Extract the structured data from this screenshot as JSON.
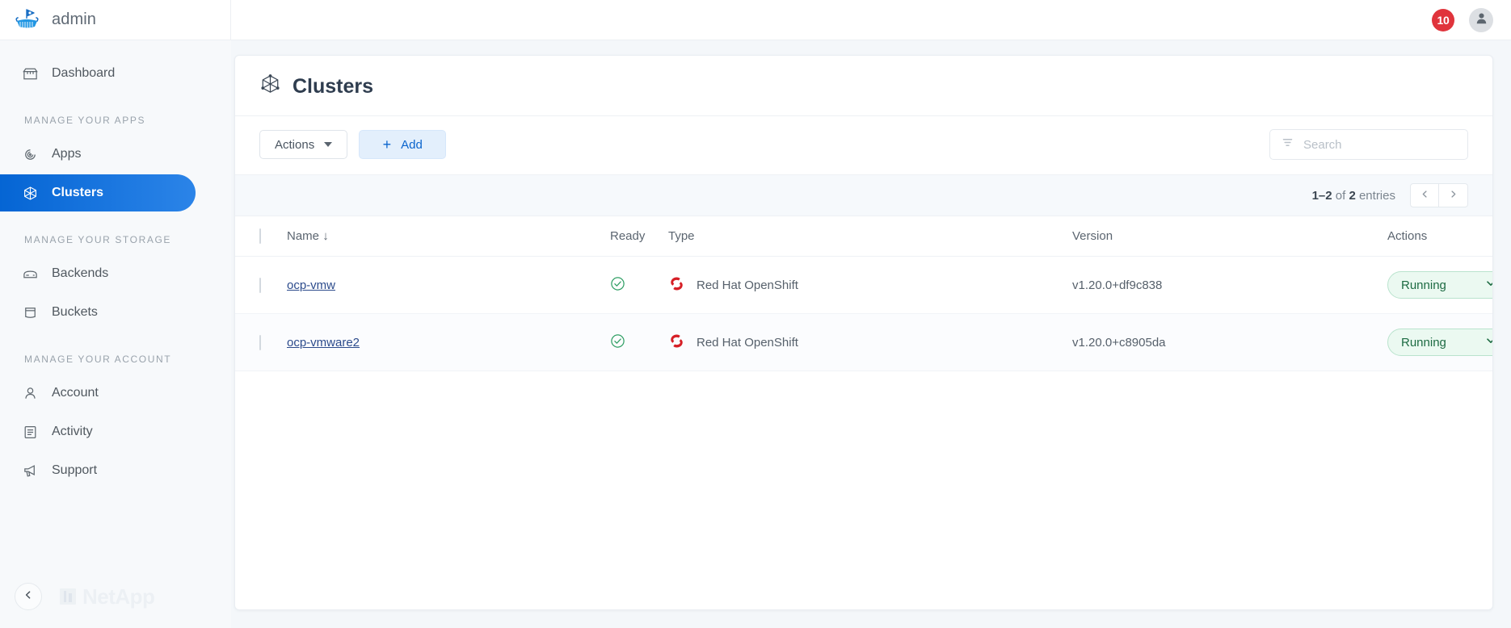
{
  "topbar": {
    "brand_name": "admin",
    "logo_icon": "viking-ship-logo",
    "notification_count": "10",
    "avatar_icon": "user-avatar-icon"
  },
  "sidebar": {
    "items": [
      {
        "label": "Dashboard",
        "icon": "dashboard-icon",
        "active": false
      },
      {
        "label": "Apps",
        "icon": "apps-icon",
        "active": false
      },
      {
        "label": "Clusters",
        "icon": "clusters-cube-icon",
        "active": true
      },
      {
        "label": "Backends",
        "icon": "backends-icon",
        "active": false
      },
      {
        "label": "Buckets",
        "icon": "buckets-icon",
        "active": false
      },
      {
        "label": "Account",
        "icon": "account-person-icon",
        "active": false
      },
      {
        "label": "Activity",
        "icon": "activity-list-icon",
        "active": false
      },
      {
        "label": "Support",
        "icon": "support-megaphone-icon",
        "active": false
      }
    ],
    "groups": {
      "apps": "MANAGE YOUR APPS",
      "storage": "MANAGE YOUR STORAGE",
      "account": "MANAGE YOUR ACCOUNT"
    },
    "footer": {
      "collapse_icon": "chevron-left-icon",
      "vendor": "NetApp"
    }
  },
  "page": {
    "title": "Clusters",
    "title_icon": "clusters-cube-icon"
  },
  "toolbar": {
    "actions_label": "Actions",
    "add_label": "Add",
    "search_placeholder": "Search",
    "search_value": "",
    "filter_icon": "filter-icon"
  },
  "pagination": {
    "range": "1–2",
    "of": " of ",
    "total": "2",
    "suffix": " entries",
    "prev_icon": "chevron-left-icon",
    "next_icon": "chevron-right-icon"
  },
  "table": {
    "columns": {
      "name": "Name",
      "ready": "Ready",
      "type": "Type",
      "version": "Version",
      "actions": "Actions"
    },
    "sort_indicator": "↓",
    "rows": [
      {
        "name": "ocp-vmw",
        "ready": "ready-check-icon",
        "type": "Red Hat OpenShift",
        "type_icon": "openshift-logo",
        "version": "v1.20.0+df9c838",
        "status": "Running"
      },
      {
        "name": "ocp-vmware2",
        "ready": "ready-check-icon",
        "type": "Red Hat OpenShift",
        "type_icon": "openshift-logo",
        "version": "v1.20.0+c8905da",
        "status": "Running"
      }
    ]
  },
  "colors": {
    "accent": "#0565d4",
    "badge": "#e0343c",
    "ready_green": "#2e9e63",
    "openshift_red": "#d61f26",
    "link": "#2c4b8c"
  }
}
